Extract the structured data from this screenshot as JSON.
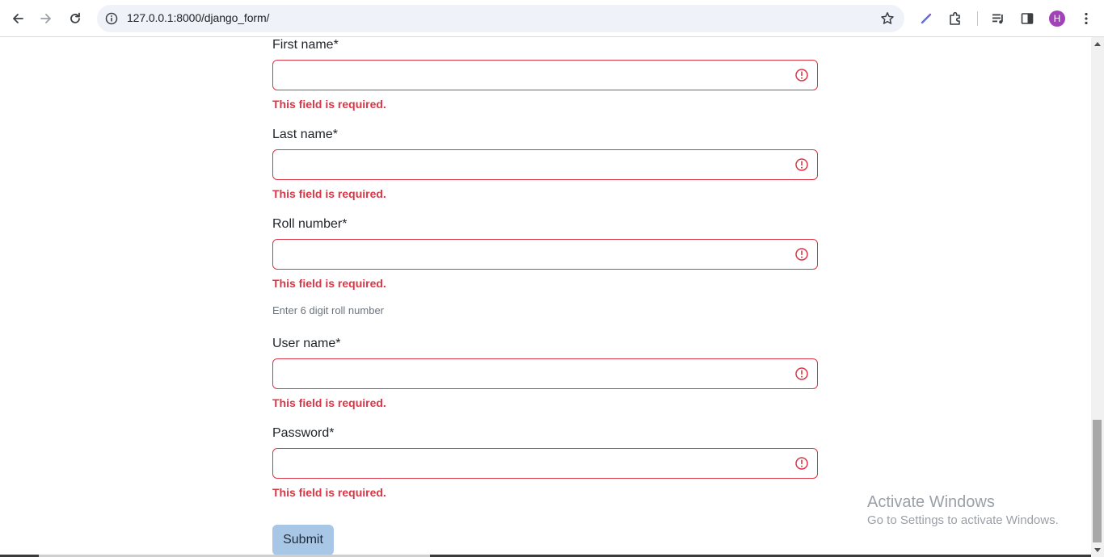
{
  "browser": {
    "url": "127.0.0.1:8000/django_form/",
    "profile_initial": "H",
    "icons": {
      "back": "back-arrow-icon",
      "forward": "forward-arrow-icon",
      "reload": "reload-icon",
      "site_info": "site-info-icon",
      "bookmark": "star-icon",
      "pen": "pen-icon",
      "extensions": "puzzle-icon",
      "media": "media-control-icon",
      "side_panel": "side-panel-icon",
      "menu": "kebab-menu-icon"
    },
    "accent_color": "#a142b8"
  },
  "form": {
    "fields": [
      {
        "label": "First name*",
        "value": "",
        "error": "This field is required."
      },
      {
        "label": "Last name*",
        "value": "",
        "error": "This field is required."
      },
      {
        "label": "Roll number*",
        "value": "",
        "error": "This field is required.",
        "help": "Enter 6 digit roll number"
      },
      {
        "label": "User name*",
        "value": "",
        "error": "This field is required."
      },
      {
        "label": "Password*",
        "value": "",
        "error": "This field is required."
      }
    ],
    "submit_label": "Submit",
    "error_color": "#dc3545"
  },
  "watermark": {
    "title": "Activate Windows",
    "subtitle": "Go to Settings to activate Windows."
  }
}
